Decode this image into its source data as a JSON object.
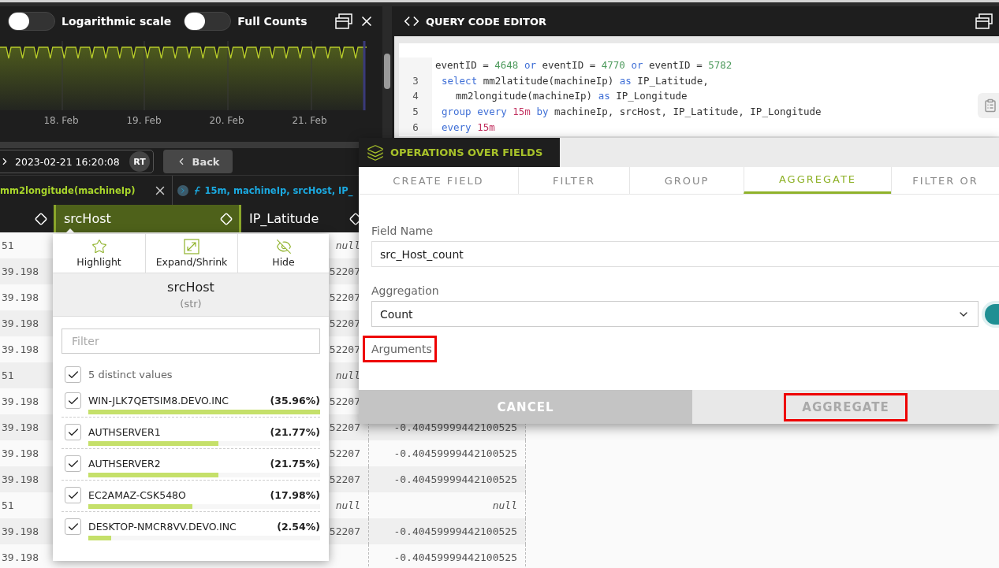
{
  "chart_panel": {
    "toggles": [
      {
        "label": "Logarithmic scale",
        "on": false
      },
      {
        "label": "Full Counts",
        "on": false
      }
    ],
    "x_labels": [
      "18. Feb",
      "19. Feb",
      "20. Feb",
      "21. Feb"
    ]
  },
  "code_editor": {
    "title": "QUERY CODE EDITOR",
    "lines": [
      {
        "kind": "continuation",
        "tokens": [
          {
            "kind": "plain",
            "text": "eventID = "
          },
          {
            "kind": "number",
            "text": "4648"
          },
          {
            "kind": "keyword",
            "text": " or "
          },
          {
            "kind": "plain",
            "text": "eventID = "
          },
          {
            "kind": "number",
            "text": "4770"
          },
          {
            "kind": "keyword",
            "text": " or "
          },
          {
            "kind": "plain",
            "text": "eventID = "
          },
          {
            "kind": "number",
            "text": "5782"
          }
        ]
      },
      {
        "number": "3",
        "kind": "statement",
        "tokens": [
          {
            "kind": "keyword",
            "text": "select"
          },
          {
            "kind": "plain",
            "text": " mm2latitude(machineIp) "
          },
          {
            "kind": "keyword",
            "text": "as"
          },
          {
            "kind": "plain",
            "text": " IP_Latitude,"
          }
        ]
      },
      {
        "number": "4",
        "kind": "nested",
        "tokens": [
          {
            "kind": "plain",
            "text": "mm2longitude(machineIp) "
          },
          {
            "kind": "keyword",
            "text": "as"
          },
          {
            "kind": "plain",
            "text": " IP_Longitude"
          }
        ]
      },
      {
        "number": "5",
        "kind": "statement",
        "tokens": [
          {
            "kind": "keyword",
            "text": "group every "
          },
          {
            "kind": "duration",
            "text": "15m"
          },
          {
            "kind": "keyword",
            "text": " by"
          },
          {
            "kind": "plain",
            "text": " machineIp, srcHost, IP_Latitude, IP_Longitude"
          }
        ]
      },
      {
        "number": "6",
        "kind": "statement",
        "tokens": [
          {
            "kind": "keyword",
            "text": "every "
          },
          {
            "kind": "duration",
            "text": "15m"
          }
        ]
      }
    ]
  },
  "toolbar": {
    "date": "2023-02-21 16:20:08",
    "badge": "RT",
    "back": "Back"
  },
  "query_chips": [
    {
      "kind": "select",
      "text": "mm2longitude(machineIp)"
    },
    {
      "kind": "group",
      "text": "15m, machineIp, srcHost, IP_"
    }
  ],
  "table": {
    "columns": [
      {
        "selected": false
      },
      {
        "label": "srcHost",
        "selected": true
      },
      {
        "label": "IP_Latitude",
        "selected": false
      }
    ],
    "rows": [
      {
        "column_1": "51",
        "column_3": "null"
      },
      {
        "column_1": "39.198",
        "column_3": "52207"
      },
      {
        "column_1": "39.198",
        "column_3": "52207"
      },
      {
        "column_1": "39.198",
        "column_3": "52207"
      },
      {
        "column_1": "39.198",
        "column_3": "52207"
      },
      {
        "column_1": "51",
        "column_3": "null"
      },
      {
        "column_1": "39.198",
        "column_3": "52207"
      },
      {
        "column_1": "39.198",
        "column_3": "52207",
        "column_4": "-0.40459999442100525"
      },
      {
        "column_1": "39.198",
        "column_3": "52207",
        "column_4": "-0.40459999442100525"
      },
      {
        "column_1": "39.198",
        "column_3": "52207",
        "column_4": "-0.40459999442100525"
      },
      {
        "column_1": "51",
        "column_3": "null",
        "column_4": "null"
      },
      {
        "column_1": "39.198",
        "column_3": "52207",
        "column_4": "-0.40459999442100525"
      },
      {
        "column_1": "39.198",
        "column_4": "-0.40459999442100525"
      }
    ]
  },
  "column_menu": {
    "actions": [
      {
        "kind": "star",
        "label": "Highlight"
      },
      {
        "kind": "expand",
        "label": "Expand/Shrink"
      },
      {
        "kind": "eye",
        "label": "Hide"
      }
    ],
    "title": "srcHost",
    "type": "(str)",
    "filter": {
      "placeholder": "Filter"
    },
    "all_values": {
      "label": "5 distinct values",
      "checked": true
    },
    "values": [
      {
        "name": "WIN-JLK7QETSIM8.DEVO.INC",
        "share": "(35.96%)",
        "checked": true,
        "level": 1.0
      },
      {
        "name": "AUTHSERVER1",
        "share": "(21.77%)",
        "checked": true,
        "level": 0.56
      },
      {
        "name": "AUTHSERVER2",
        "share": "(21.75%)",
        "checked": true,
        "level": 0.56
      },
      {
        "name": "EC2AMAZ-CSK548O",
        "share": "(17.98%)",
        "checked": true,
        "level": 0.45
      },
      {
        "name": "DESKTOP-NMCR8VV.DEVO.INC",
        "share": "(2.54%)",
        "checked": true,
        "level": 0.1
      }
    ]
  },
  "operations_dialog": {
    "title": "OPERATIONS OVER FIELDS",
    "tabs": [
      {
        "label": "CREATE FIELD",
        "selected": false
      },
      {
        "label": "FILTER",
        "selected": false
      },
      {
        "label": "GROUP",
        "selected": false
      },
      {
        "label": "AGGREGATE",
        "selected": true
      },
      {
        "label": "FILTER OR",
        "selected": false
      }
    ],
    "field_name": {
      "label": "Field Name",
      "value": "src_Host_count"
    },
    "aggregation": {
      "label": "Aggregation",
      "value": "Count"
    },
    "arguments": {
      "label": "Arguments",
      "highlighted": true
    },
    "buttons": [
      {
        "kind": "cancel",
        "label": "CANCEL",
        "disabled": false,
        "highlighted": false
      },
      {
        "kind": "submit",
        "label": "AGGREGATE",
        "disabled": true,
        "highlighted": true
      }
    ]
  }
}
